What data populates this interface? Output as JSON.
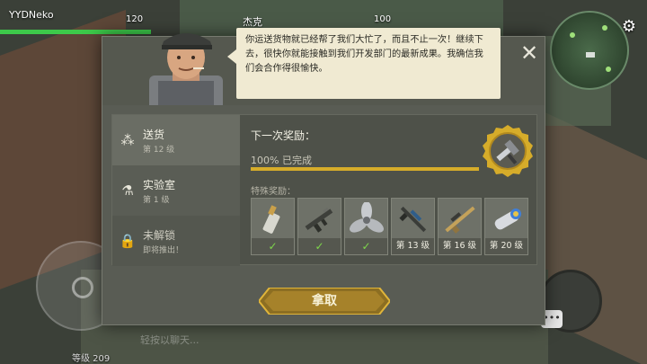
{
  "hud": {
    "player_name": "YYDNeko",
    "player_hp": "120",
    "partner_name": "杰克",
    "partner_hp": "100",
    "chat_placeholder": "轻按以聊天...",
    "level_text": "等级 209"
  },
  "dialog": {
    "speech": "你运送货物就已经帮了我们大忙了，而且不止一次！继续下去，很快你就能接触到我们开发部门的最新成果。我确信我们会合作得很愉快。",
    "close_symbol": "✕",
    "tabs": [
      {
        "name": "送货",
        "sub": "第 12 级",
        "icon": "gift-boxes-icon"
      },
      {
        "name": "实验室",
        "sub": "第 1 级",
        "icon": "flask-icon"
      },
      {
        "name": "未解锁",
        "sub": "即将推出！",
        "icon": "padlock-icon"
      }
    ],
    "next_reward_title": "下一次奖励：",
    "progress_text": "100% 已完成",
    "progress_value": 1.0,
    "special_reward_label": "特殊奖励：",
    "rewards": [
      {
        "icon": "ammo-cartridge-icon",
        "status": "✓"
      },
      {
        "icon": "assault-rifle-icon",
        "status": "✓"
      },
      {
        "icon": "propeller-icon",
        "status": "✓"
      },
      {
        "icon": "scoped-rifle-icon",
        "status": "第 13 级"
      },
      {
        "icon": "sniper-rifle-icon",
        "status": "第 16 级"
      },
      {
        "icon": "dyed-tube-icon",
        "status": "第 20 级"
      }
    ],
    "claim_label": "拿取"
  },
  "colors": {
    "accent_gold": "#d6ac2a",
    "hp_green": "#3dc94a",
    "check_green": "#7ed64b",
    "speech_bg": "#f0ead2"
  }
}
